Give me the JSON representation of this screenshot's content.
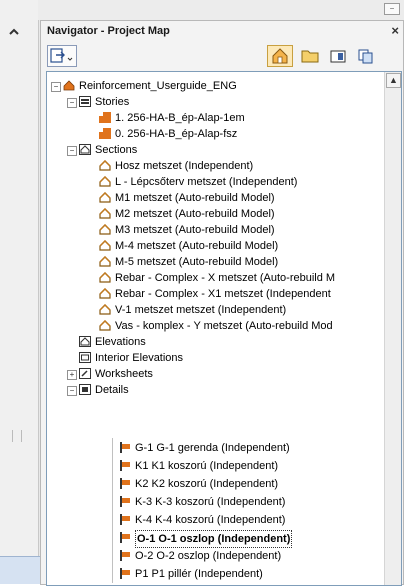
{
  "window": {
    "panel_title": "Navigator - Project Map",
    "close_symbol": "×",
    "mini_symbol": "−"
  },
  "toolbar": {
    "buttons": [
      {
        "name": "navigator-mode-icon",
        "selected": false
      },
      {
        "name": "project-map-icon",
        "selected": true
      },
      {
        "name": "view-map-icon",
        "selected": false
      },
      {
        "name": "layout-book-icon",
        "selected": false
      },
      {
        "name": "publisher-sets-icon",
        "selected": false
      }
    ]
  },
  "tree": {
    "root": "Reinforcement_Userguide_ENG",
    "stories_label": "Stories",
    "stories": [
      "1. 256-HA-B_ép-Alap-1em",
      "0. 256-HA-B_ép-Alap-fsz"
    ],
    "sections_label": "Sections",
    "sections": [
      "Hosz metszet (Independent)",
      "L - Lépcsőterv metszet (Independent)",
      "M1 metszet (Auto-rebuild Model)",
      "M2 metszet (Auto-rebuild Model)",
      "M3 metszet (Auto-rebuild Model)",
      "M-4 metszet (Auto-rebuild Model)",
      "M-5 metszet (Auto-rebuild Model)",
      "Rebar - Complex - X metszet (Auto-rebuild M",
      "Rebar - Complex - X1 metszet (Independent",
      "V-1 metszet metszet (Independent)",
      "Vas - komplex - Y metszet (Auto-rebuild Mod"
    ],
    "elevations_label": "Elevations",
    "interior_elevations_label": "Interior Elevations",
    "worksheets_label": "Worksheets",
    "details_label": "Details",
    "details": [
      "G-1 G-1 gerenda (Independent)",
      "K1 K1 koszorú (Independent)",
      "K2 K2 koszorú (Independent)",
      "K-3 K-3 koszorú (Independent)",
      "K-4 K-4 koszorú (Independent)",
      "O-1 O-1 oszlop (Independent)",
      "O-2 O-2 oszlop (Independent)",
      "P1 P1 pillér (Independent)"
    ],
    "selected_detail_index": 5
  },
  "colors": {
    "story_icon": "#d86a1c",
    "house_icon": "#b07a2a",
    "selection_bg": "#ffffff",
    "panel_bg": "#f3f3f3",
    "tree_border": "#7f9db9"
  }
}
